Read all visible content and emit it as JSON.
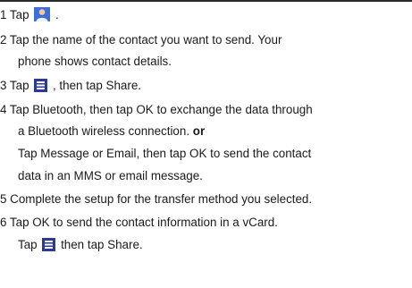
{
  "steps": {
    "s1": {
      "before": "1 Tap",
      "after": "."
    },
    "s2": {
      "line1": "2 Tap the name of the contact you want to send. Your",
      "line2": "phone shows contact details."
    },
    "s3": {
      "before": "3 Tap",
      "after": ", then tap Share."
    },
    "s4": {
      "line1": "4 Tap Bluetooth, then tap OK to exchange the data through",
      "line2_text": "a Bluetooth wireless connection.",
      "line2_bold": "or",
      "line3": "Tap Message or Email, then tap OK to send the contact",
      "line4": "data in an MMS or email message."
    },
    "s5": {
      "line1": "5 Complete the setup for the transfer method you selected."
    },
    "s6": {
      "line1": "6 Tap OK to send the contact information in a vCard.",
      "line2_before": "Tap",
      "line2_after": "then tap Share."
    }
  },
  "icons": {
    "contacts": {
      "name": "contacts-person-icon",
      "color": "#3e6fd6"
    },
    "menu": {
      "name": "menu-icon",
      "color": "#2b3a97"
    }
  }
}
